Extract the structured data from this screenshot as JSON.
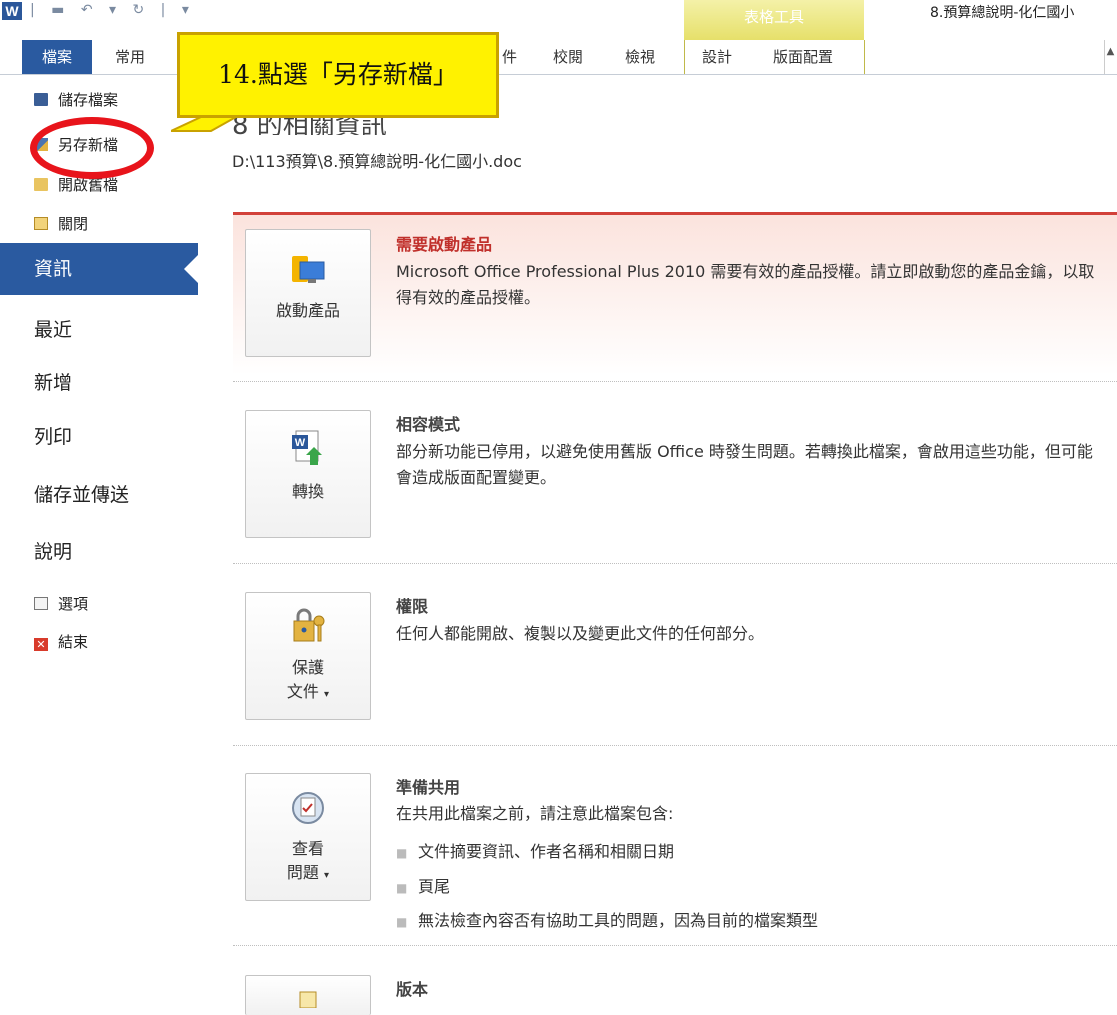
{
  "titlebar": {
    "app_icon_letter": "W",
    "quick_access": "| ▬  ↶ ▾  ↻ | ▾",
    "contextual_group": "表格工具",
    "doc_title": "8.預算總說明-化仁國小"
  },
  "tabs": {
    "file": "檔案",
    "home": "常用",
    "mailings_partial": "件",
    "review": "校閱",
    "view": "檢視",
    "design": "設計",
    "layout": "版面配置"
  },
  "leftnav": {
    "save": "儲存檔案",
    "save_as": "另存新檔",
    "open": "開啟舊檔",
    "close": "關閉",
    "info": "資訊",
    "recent": "最近",
    "new": "新增",
    "print": "列印",
    "save_send": "儲存並傳送",
    "help": "說明",
    "options": "選項",
    "exit": "結束"
  },
  "callout": {
    "text": "14.點選「另存新檔」",
    "color": "#fff200",
    "ring_color": "#e8141b"
  },
  "main": {
    "heading": "8 的相關資訊",
    "path": "D:\\113預算\\8.預算總說明-化仁國小.doc",
    "sections": [
      {
        "button_label": "啟動產品",
        "title": "需要啟動產品",
        "desc": "Microsoft Office Professional Plus 2010 需要有效的產品授權。請立即啟動您的產品金鑰，以取得有效的產品授權。"
      },
      {
        "button_label": "轉換",
        "title": "相容模式",
        "desc": "部分新功能已停用，以避免使用舊版 Office 時發生問題。若轉換此檔案，會啟用這些功能，但可能會造成版面配置變更。"
      },
      {
        "button_label_1": "保護",
        "button_label_2": "文件",
        "title": "權限",
        "desc": "任何人都能開啟、複製以及變更此文件的任何部分。"
      },
      {
        "button_label_1": "查看",
        "button_label_2": "問題",
        "title": "準備共用",
        "desc": "在共用此檔案之前，請注意此檔案包含:",
        "bullets": [
          "文件摘要資訊、作者名稱和相關日期",
          "頁尾",
          "無法檢查內容否有協助工具的問題，因為目前的檔案類型"
        ]
      },
      {
        "title": "版本"
      }
    ]
  }
}
